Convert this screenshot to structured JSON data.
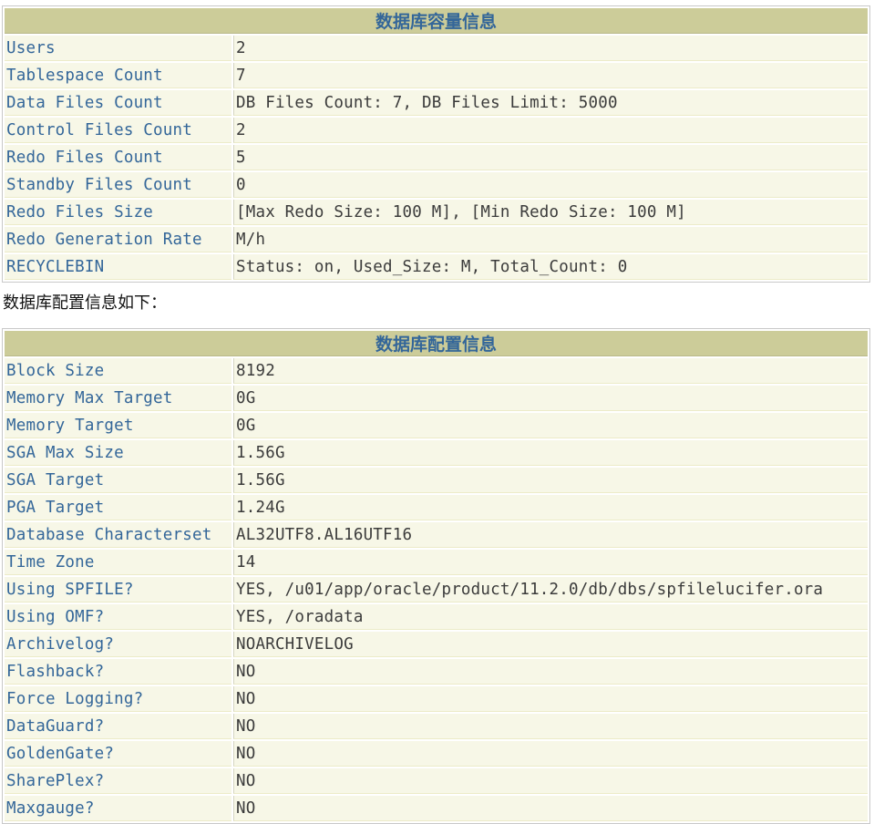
{
  "capacity": {
    "title": "数据库容量信息",
    "rows": [
      {
        "label": "Users",
        "value": "2"
      },
      {
        "label": "Tablespace Count",
        "value": "7"
      },
      {
        "label": "Data Files Count",
        "value": "DB Files Count: 7, DB Files Limit: 5000"
      },
      {
        "label": "Control Files Count",
        "value": "2"
      },
      {
        "label": "Redo Files Count",
        "value": "5"
      },
      {
        "label": "Standby Files Count",
        "value": "0"
      },
      {
        "label": "Redo Files Size",
        "value": "[Max Redo Size: 100 M], [Min Redo Size: 100 M]"
      },
      {
        "label": "Redo Generation Rate",
        "value": "M/h"
      },
      {
        "label": "RECYCLEBIN",
        "value": "Status: on, Used_Size: M, Total_Count: 0"
      }
    ]
  },
  "intro_text": "数据库配置信息如下：",
  "config": {
    "title": "数据库配置信息",
    "rows": [
      {
        "label": "Block Size",
        "value": "8192"
      },
      {
        "label": "Memory Max Target",
        "value": "0G"
      },
      {
        "label": "Memory Target",
        "value": "0G"
      },
      {
        "label": "SGA Max Size",
        "value": "1.56G"
      },
      {
        "label": "SGA Target",
        "value": "1.56G"
      },
      {
        "label": "PGA Target",
        "value": "1.24G"
      },
      {
        "label": "Database Characterset",
        "value": "AL32UTF8.AL16UTF16"
      },
      {
        "label": "Time Zone",
        "value": "14"
      },
      {
        "label": "Using SPFILE?",
        "value": "YES, /u01/app/oracle/product/11.2.0/db/dbs/spfilelucifer.ora"
      },
      {
        "label": "Using OMF?",
        "value": "YES, /oradata"
      },
      {
        "label": "Archivelog?",
        "value": "NOARCHIVELOG"
      },
      {
        "label": "Flashback?",
        "value": "NO"
      },
      {
        "label": "Force Logging?",
        "value": "NO"
      },
      {
        "label": "DataGuard?",
        "value": "NO"
      },
      {
        "label": "GoldenGate?",
        "value": "NO"
      },
      {
        "label": "SharePlex?",
        "value": "NO"
      },
      {
        "label": "Maxgauge?",
        "value": "NO"
      }
    ]
  },
  "colors": {
    "header_bg": "#cccc99",
    "header_text": "#336699",
    "cell_bg": "#f7f7e7",
    "label_text": "#336699",
    "value_text": "#3b3b3b"
  }
}
